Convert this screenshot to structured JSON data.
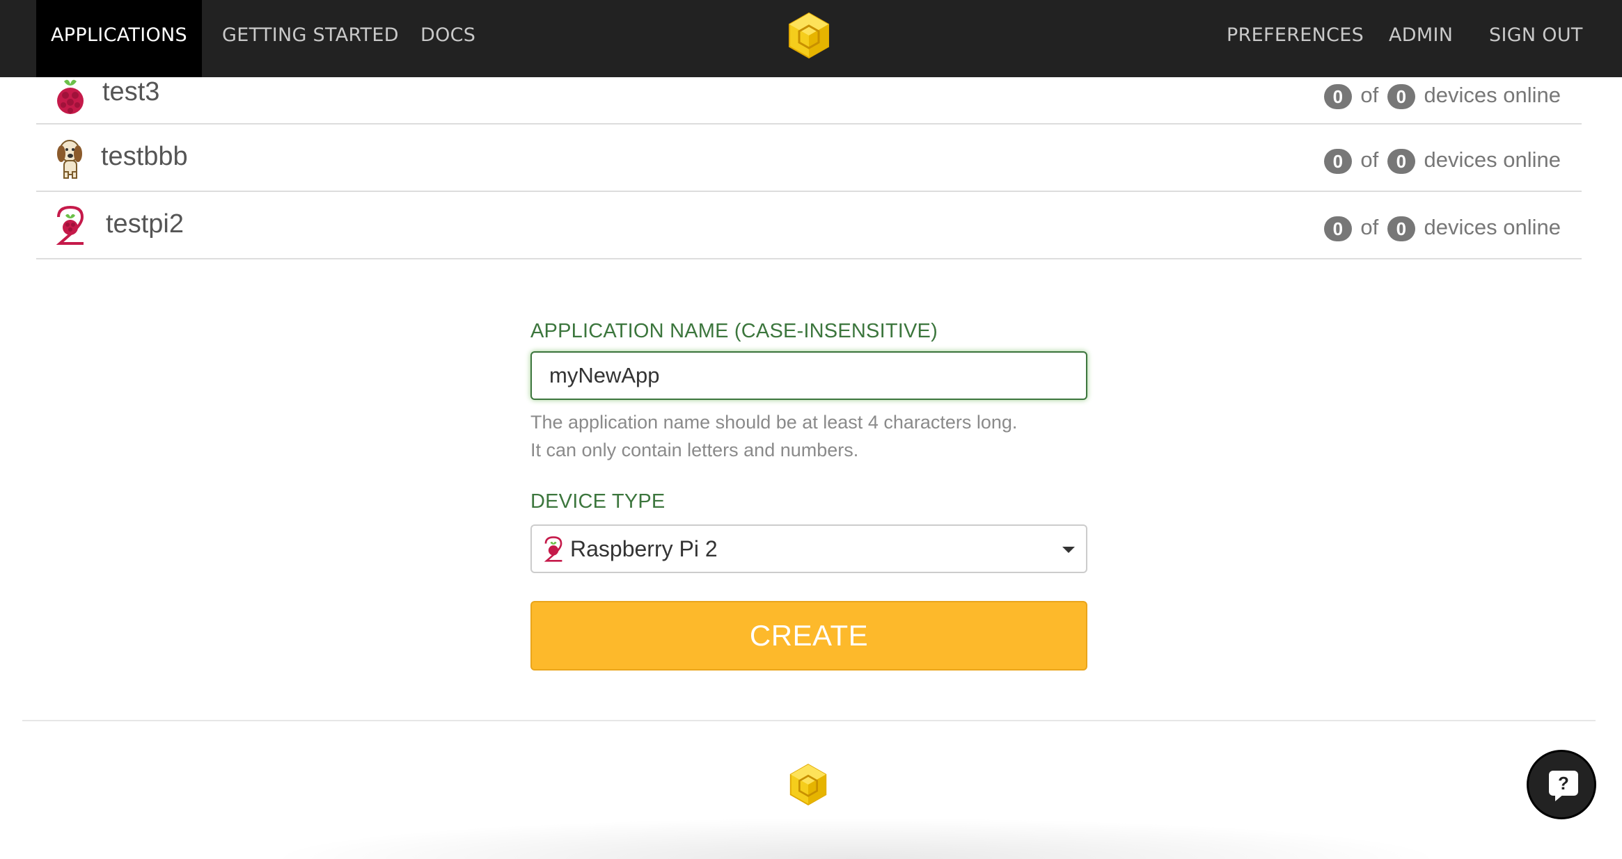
{
  "nav": {
    "left": [
      {
        "label": "APPLICATIONS",
        "active": true
      },
      {
        "label": "GETTING STARTED"
      },
      {
        "label": "DOCS"
      }
    ],
    "right": [
      {
        "label": "PREFERENCES"
      },
      {
        "label": "ADMIN"
      },
      {
        "label": "SIGN OUT"
      }
    ],
    "logo_icon": "cube-logo-icon"
  },
  "applications": [
    {
      "name": "test3",
      "icon": "raspberry-pi-icon",
      "online": "0",
      "of": "of",
      "total": "0",
      "suffix": "devices online"
    },
    {
      "name": "testbbb",
      "icon": "beaglebone-dog-icon",
      "online": "0",
      "of": "of",
      "total": "0",
      "suffix": "devices online"
    },
    {
      "name": "testpi2",
      "icon": "raspberry-pi-2-icon",
      "online": "0",
      "of": "of",
      "total": "0",
      "suffix": "devices online"
    }
  ],
  "form": {
    "name_label": "APPLICATION NAME (CASE-INSENSITIVE)",
    "name_value": "myNewApp",
    "help_line1": "The application name should be at least 4 characters long.",
    "help_line2": "It can only contain letters and numbers.",
    "device_label": "DEVICE TYPE",
    "device_value": "Raspberry Pi 2",
    "create_label": "CREATE"
  },
  "footer": {
    "help_label": "?"
  },
  "colors": {
    "nav_bg": "#222222",
    "accent": "#fdb92b",
    "success_label": "#3c763d",
    "badge": "#777777"
  }
}
